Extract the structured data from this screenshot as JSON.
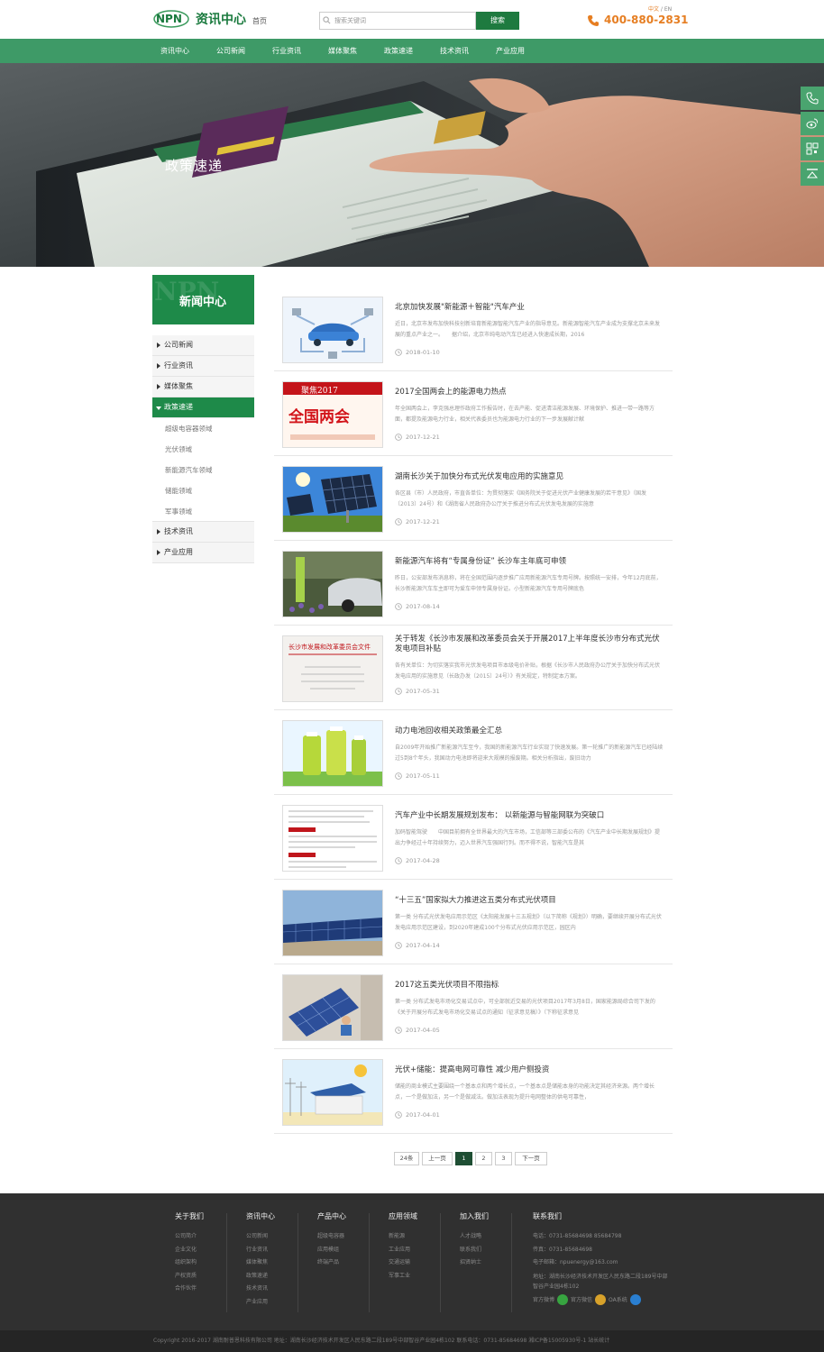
{
  "header": {
    "logo_mark": "NPN",
    "logo_text": "资讯中心",
    "home_link": "首页",
    "search_placeholder": "搜索关键词",
    "search_button": "搜索",
    "lang_cn": "中文",
    "lang_sep": " / ",
    "lang_en": "EN",
    "hotline": "400-880-2831"
  },
  "nav": [
    {
      "label": "资讯中心"
    },
    {
      "label": "公司新闻"
    },
    {
      "label": "行业资讯"
    },
    {
      "label": "媒体聚焦"
    },
    {
      "label": "政策速递"
    },
    {
      "label": "技术资讯"
    },
    {
      "label": "产业应用"
    }
  ],
  "banner": {
    "title": "政策速递"
  },
  "sidebar": {
    "head_mark": "NPN",
    "title": "新闻中心",
    "items": [
      {
        "label": "公司新闻"
      },
      {
        "label": "行业资讯"
      },
      {
        "label": "媒体聚焦"
      },
      {
        "label": "政策速递"
      },
      {
        "label": "技术资讯"
      },
      {
        "label": "产业应用"
      }
    ],
    "subitems": [
      {
        "label": "超级电容器领域"
      },
      {
        "label": "光伏领域"
      },
      {
        "label": "新能源汽车领域"
      },
      {
        "label": "储能领域"
      },
      {
        "label": "军事领域"
      }
    ]
  },
  "articles": [
    {
      "title": "北京加快发展\"新能源＋智能\"汽车产业",
      "summary": "近日，北京市发布加快科技创新培育新能源智能汽车产业的指导意见。新能源智能汽车产业成为支撑北京未来发展的重点产业之一。　　据介绍，北京市纯电动汽车已经进入快速成长期，2016",
      "date": "2018-01-10"
    },
    {
      "title": "2017全国两会上的能源电力热点",
      "summary": "年全国两会上，李克强总理作政府工作报告时，在去产能、促进清洁能源发展、环境保护、推进一带一路等方面，都提及能源电力行业，相关代表委员也为能源电力行业的下一步发展献计献",
      "date": "2017-12-21"
    },
    {
      "title": "湖南长沙关于加快分布式光伏发电应用的实施意见",
      "summary": "各区县（市）人民政府，市直各单位：为贯彻落实《国务院关于促进光伏产业健康发展的若干意见》（国发〔2013〕24号）和《湖南省人民政府办公厅关于推进分布式光伏发电发展的实施意",
      "date": "2017-12-21"
    },
    {
      "title": "新能源汽车将有“专属身份证” 长沙车主年底可申领",
      "summary": "昨日，公安部发布消息称，将在全国范围内逐步推广应用新能源汽车专用号牌。按照统一安排，今年12月底前，长沙新能源汽车车主即可为爱车申领专属身份证。小型新能源汽车专用号牌底色",
      "date": "2017-08-14"
    },
    {
      "title": "关于转发《长沙市发展和改革委员会关于开展2017上半年度长沙市分布式光伏发电项目补贴",
      "summary": "各有关单位：为切实落实我市光伏发电项目市本级电价补贴，根据《长沙市人民政府办公厅关于加快分布式光伏发电应用的实施意见（长政办发〔2015〕24号）》有关规定，特制定本方案。",
      "date": "2017-05-31"
    },
    {
      "title": "动力电池回收相关政策最全汇总",
      "summary": "自2009年开始推广新能源汽车至今，我国的新能源汽车行业实现了快速发展。第一轮推广的新能源汽车已经陆续过5到8个年头，我国动力电池即将迎来大规模的报废期。相关分析指出，废旧动力",
      "date": "2017-05-11"
    },
    {
      "title": "汽车产业中长期发展规划发布： 以新能源与智能网联为突破口",
      "summary": "加码智能驾驶　　中国目前拥有全世界最大的汽车市场，工信部等三部委公布的《汽车产业中长期发展规划》提出力争经过十年持续努力，迈入世界汽车强国行列。而不得不说，智能汽车是其",
      "date": "2017-04-28"
    },
    {
      "title": "“十三五”国家拟大力推进这五类分布式光伏项目",
      "summary": "第一类 分布式光伏发电应用示范区《太阳能发展十三五规划》（以下简称《规划》）明确，要继续开展分布式光伏发电应用示范区建设，到2020年建成100个分布式光伏应用示范区，园区内",
      "date": "2017-04-14"
    },
    {
      "title": "2017这五类光伏项目不限指标",
      "summary": "第一类 分布式发电市场化交易试点中，可全部就近交易的光伏项目2017年3月8日，国家能源局综合司下发的《关于开展分布式发电市场化交易试点的通知（征求意见稿）》（下称征求意见",
      "date": "2017-04-05"
    },
    {
      "title": "光伏+储能：提高电网可靠性 减少用户侧投资",
      "summary": "储能的商业模式主要围绕一个基本点和两个增长点，一个基本点是储能本身的功能决定其经济来源。两个增长点，一个是做加法，另一个是做减法。做加法表现为提升电网整体的供电可靠性，",
      "date": "2017-04-01"
    }
  ],
  "pager": {
    "total": "24条",
    "prev": "上一页",
    "pages": [
      "1",
      "2",
      "3"
    ],
    "current": "1",
    "next": "下一页"
  },
  "footer": {
    "columns": [
      {
        "title": "关于我们",
        "items": [
          "公司简介",
          "企业文化",
          "组织架构",
          "产权资质",
          "合作伙伴"
        ]
      },
      {
        "title": "资讯中心",
        "items": [
          "公司新闻",
          "行业资讯",
          "媒体聚焦",
          "政策速递",
          "技术资讯",
          "产业应用"
        ]
      },
      {
        "title": "产品中心",
        "items": [
          "超级电容器",
          "应用模组",
          "终端产品"
        ]
      },
      {
        "title": "应用领域",
        "items": [
          "新能源",
          "工业应用",
          "交通运输",
          "军事工业"
        ]
      },
      {
        "title": "加入我们",
        "items": [
          "人才战略",
          "联系我们",
          "招贤纳士"
        ]
      }
    ],
    "contact": {
      "title": "联系我们",
      "phone": "电话：0731-85684698 85684798",
      "fax": "传真：0731-85684698",
      "email": "电子邮箱：npuenergy@163.com",
      "address": "地址：湖南长沙经济技术开发区人民东路二段189号中部智谷产业园4栋102",
      "social_label": "官方微博",
      "wechat": "官方微信",
      "weibo": "官方微博",
      "oa": "OA系统"
    },
    "copyright": "Copyright 2016-2017 湖南耐普恩科技有限公司 地址：湖南长沙经济技术开发区人民东路二段189号中部智谷产业园4栋102 联系电话：0731-85684698 湘ICP备15005930号-1 站长统计"
  },
  "colors": {
    "brand_green": "#1e8a49",
    "nav_green": "#3e9a67",
    "accent_orange": "#e67e22",
    "footer_bg": "#303030"
  }
}
